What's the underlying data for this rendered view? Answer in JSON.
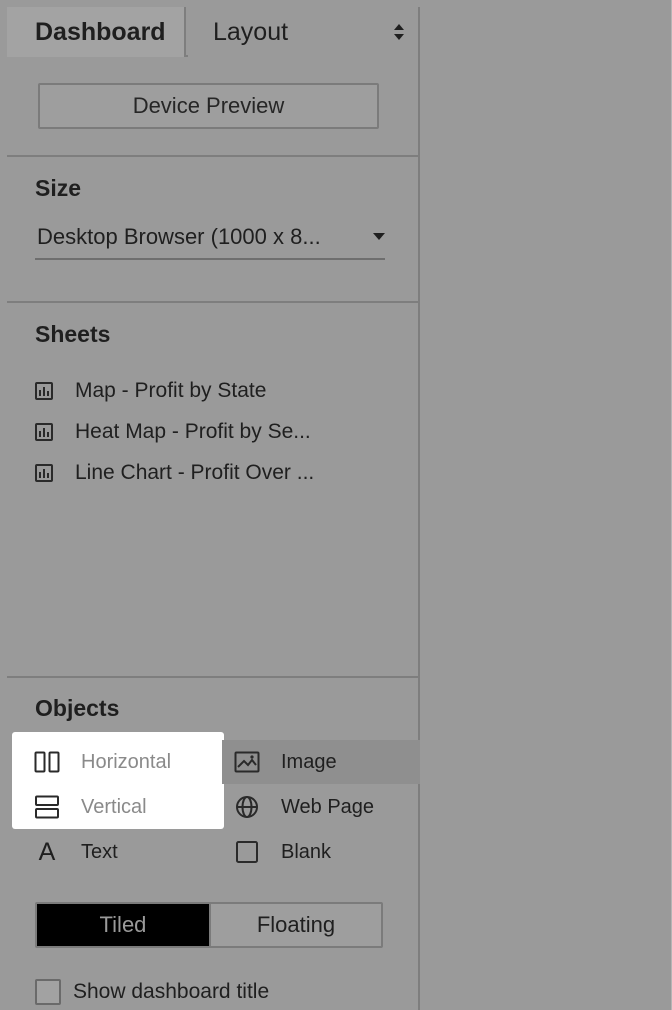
{
  "tabs": {
    "dashboard": "Dashboard",
    "layout": "Layout"
  },
  "device_preview": {
    "label": "Device Preview"
  },
  "size": {
    "title": "Size",
    "dropdown_value": "Desktop Browser (1000 x 8..."
  },
  "sheets": {
    "title": "Sheets",
    "items": [
      {
        "label": "Map - Profit by State",
        "icon": "worksheet-icon"
      },
      {
        "label": "Heat Map - Profit by Se...",
        "icon": "worksheet-icon"
      },
      {
        "label": "Line Chart - Profit Over ...",
        "icon": "worksheet-icon"
      }
    ]
  },
  "objects": {
    "title": "Objects",
    "items": [
      {
        "label": "Horizontal",
        "icon": "horizontal-container-icon"
      },
      {
        "label": "Vertical",
        "icon": "vertical-container-icon"
      },
      {
        "label": "Text",
        "icon": "text-icon"
      },
      {
        "label": "Image",
        "icon": "image-icon"
      },
      {
        "label": "Web Page",
        "icon": "globe-icon"
      },
      {
        "label": "Blank",
        "icon": "blank-icon"
      }
    ]
  },
  "placement": {
    "tiled": "Tiled",
    "floating": "Floating",
    "selected": "Tiled"
  },
  "show_title": {
    "label": "Show dashboard title",
    "checked": false
  },
  "colors": {
    "panel_bg": "#9a9a9a",
    "highlight": "#ffffff",
    "selected_toggle": "#000000"
  }
}
